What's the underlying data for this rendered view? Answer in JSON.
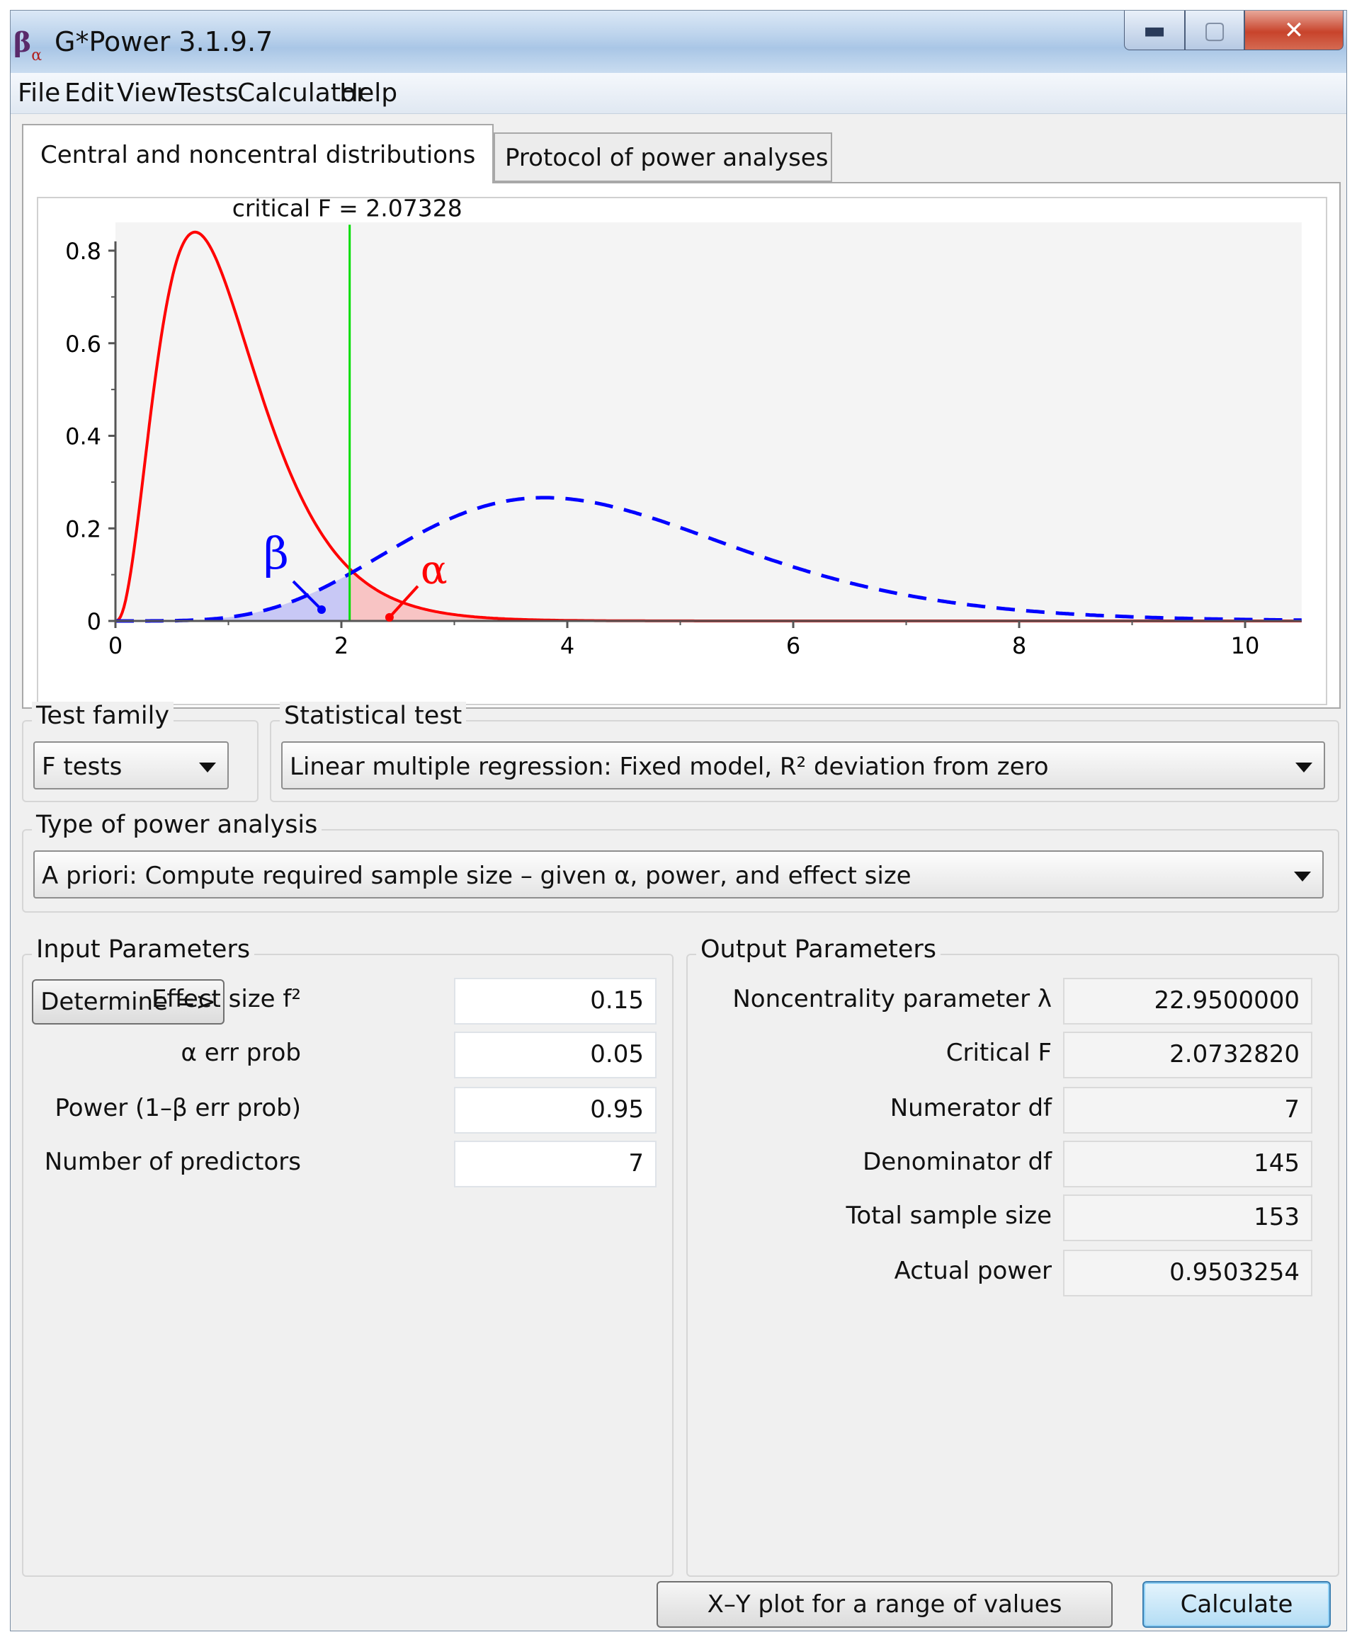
{
  "window": {
    "title": "G*Power 3.1.9.7",
    "icon_beta": "β",
    "icon_alpha": "α",
    "controls": {
      "minimize": "minimize-icon",
      "maximize": "maximize-icon",
      "close": "close-icon"
    }
  },
  "menu": [
    "File",
    "Edit",
    "View",
    "Tests",
    "Calculator",
    "Help"
  ],
  "tabs": {
    "central": "Central and noncentral distributions",
    "protocol": "Protocol of power analyses"
  },
  "chart_data": {
    "type": "line",
    "annotation": "critical F = 2.07328",
    "critical_f": 2.07328,
    "xlim": [
      0,
      10.5
    ],
    "ylim": [
      0,
      0.85
    ],
    "x_ticks": [
      0,
      2,
      4,
      6,
      8,
      10
    ],
    "y_ticks": [
      0,
      0.2,
      0.4,
      0.6,
      0.8
    ],
    "x_tick_labels": [
      "0",
      "2",
      "4",
      "6",
      "8",
      "10"
    ],
    "y_tick_labels": [
      "0",
      "0.2",
      "0.4",
      "0.6",
      "0.8"
    ],
    "markers": {
      "beta": "β",
      "alpha": "α"
    },
    "series": [
      {
        "role": "central",
        "color": "#ff0000",
        "style": "solid",
        "df1": 7,
        "df2": 145,
        "lambda": 0
      },
      {
        "role": "noncentral",
        "color": "#0000ff",
        "style": "dashed",
        "df1": 7,
        "df2": 145,
        "lambda": 22.95
      }
    ],
    "colors": {
      "critical_line": "#00dd00",
      "beta_fill": "#c8c8f5",
      "alpha_fill": "#f8c4c4",
      "plot_bg": "#f4f4f4"
    }
  },
  "test_family": {
    "label": "Test family",
    "value": "F tests"
  },
  "statistical_test": {
    "label": "Statistical test",
    "value": "Linear multiple regression: Fixed model, R² deviation from zero"
  },
  "power_analysis": {
    "label": "Type of power analysis",
    "value": "A priori: Compute required sample size – given α, power, and effect size"
  },
  "input": {
    "title": "Input Parameters",
    "determine": "Determine =>",
    "params": [
      {
        "label": "Effect size f²",
        "value": "0.15"
      },
      {
        "label": "α err prob",
        "value": "0.05"
      },
      {
        "label": "Power (1–β err prob)",
        "value": "0.95"
      },
      {
        "label": "Number of predictors",
        "value": "7"
      }
    ]
  },
  "output": {
    "title": "Output Parameters",
    "params": [
      {
        "label": "Noncentrality parameter λ",
        "value": "22.9500000"
      },
      {
        "label": "Critical F",
        "value": "2.0732820"
      },
      {
        "label": "Numerator df",
        "value": "7"
      },
      {
        "label": "Denominator df",
        "value": "145"
      },
      {
        "label": "Total sample size",
        "value": "153"
      },
      {
        "label": "Actual power",
        "value": "0.9503254"
      }
    ]
  },
  "buttons": {
    "xy_plot": "X–Y plot for a range of values",
    "calculate": "Calculate"
  }
}
